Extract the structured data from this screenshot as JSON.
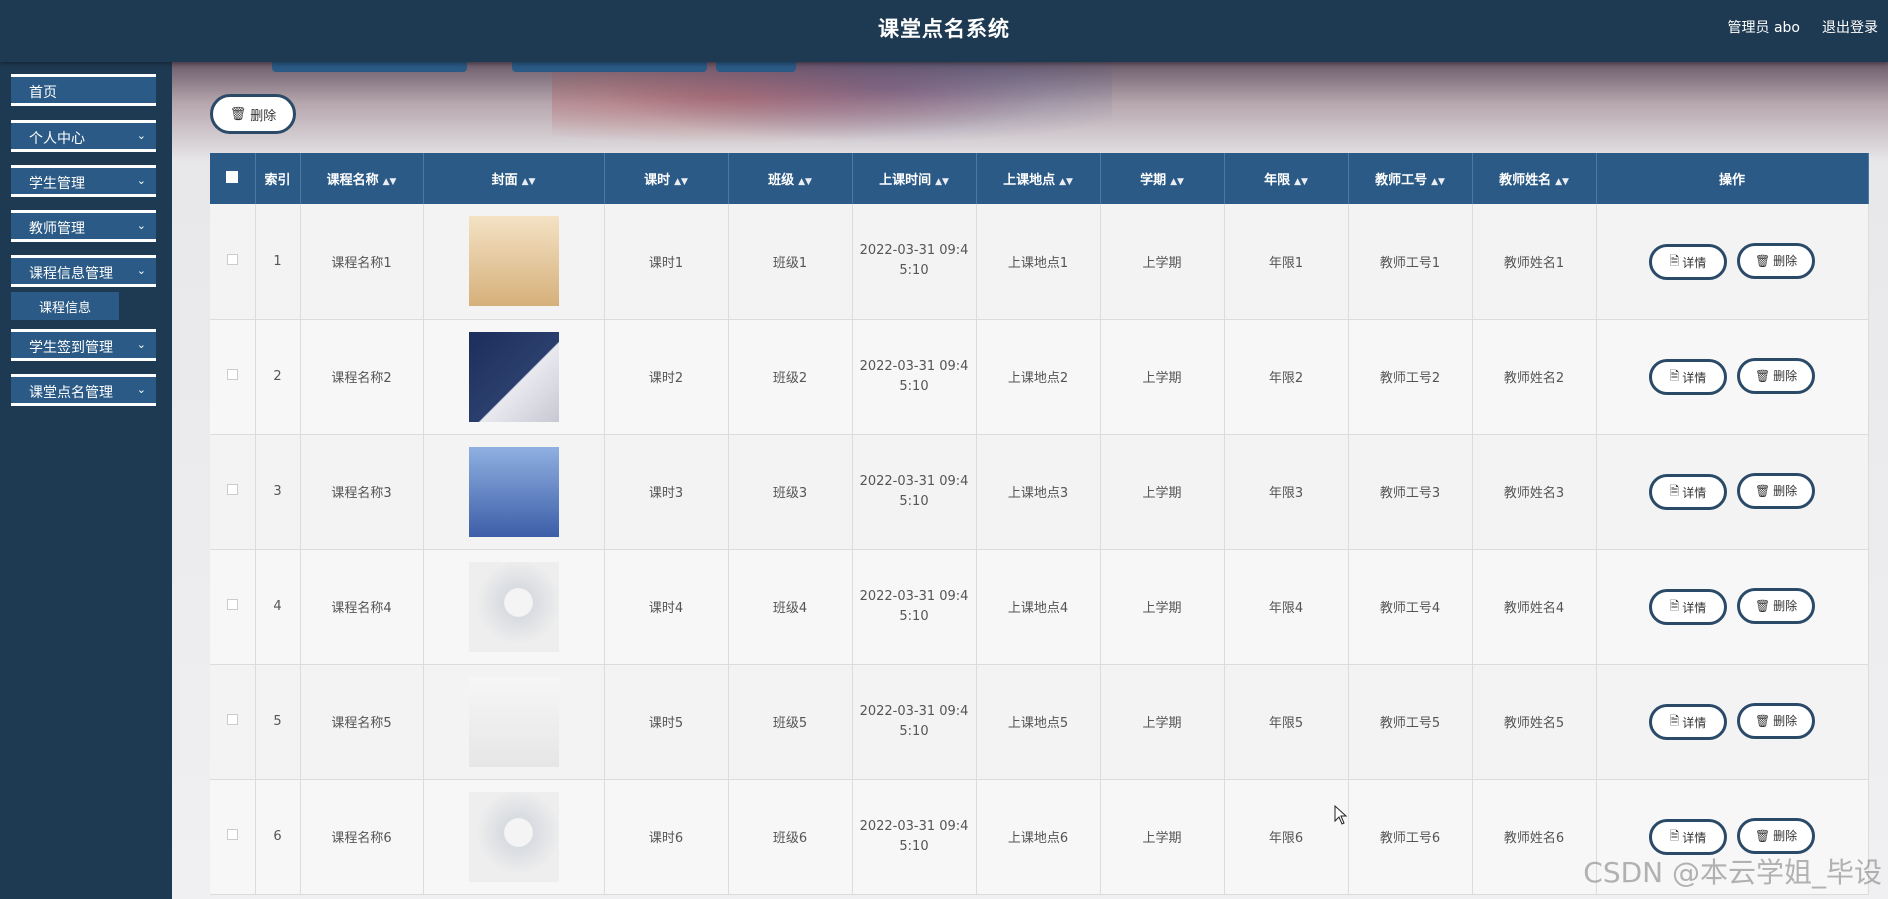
{
  "header": {
    "title": "课堂点名系统",
    "user": "管理员 abo",
    "logout": "退出登录"
  },
  "sidebar": {
    "items": [
      {
        "label": "首页",
        "has_arrow": false
      },
      {
        "label": "个人中心",
        "has_arrow": true
      },
      {
        "label": "学生管理",
        "has_arrow": true
      },
      {
        "label": "教师管理",
        "has_arrow": true
      },
      {
        "label": "课程信息管理",
        "has_arrow": true
      },
      {
        "label": "学生签到管理",
        "has_arrow": true
      },
      {
        "label": "课堂点名管理",
        "has_arrow": true
      }
    ],
    "sub_items": [
      {
        "label": "课程信息",
        "parent": "课程信息管理"
      }
    ]
  },
  "toolbar": {
    "delete_label": "删除"
  },
  "table": {
    "columns": [
      "索引",
      "课程名称",
      "封面",
      "课时",
      "班级",
      "上课时间",
      "上课地点",
      "学期",
      "年限",
      "教师工号",
      "教师姓名",
      "操作"
    ],
    "rows": [
      {
        "index": "1",
        "name": "课程名称1",
        "cover": "cover1",
        "hours": "课时1",
        "class": "班级1",
        "time_a": "2022-03-31 09:4",
        "time_b": "5:10",
        "place": "上课地点1",
        "term": "上学期",
        "years": "年限1",
        "teacher_id": "教师工号1",
        "teacher_name": "教师姓名1"
      },
      {
        "index": "2",
        "name": "课程名称2",
        "cover": "cover2",
        "hours": "课时2",
        "class": "班级2",
        "time_a": "2022-03-31 09:4",
        "time_b": "5:10",
        "place": "上课地点2",
        "term": "上学期",
        "years": "年限2",
        "teacher_id": "教师工号2",
        "teacher_name": "教师姓名2"
      },
      {
        "index": "3",
        "name": "课程名称3",
        "cover": "cover3",
        "hours": "课时3",
        "class": "班级3",
        "time_a": "2022-03-31 09:4",
        "time_b": "5:10",
        "place": "上课地点3",
        "term": "上学期",
        "years": "年限3",
        "teacher_id": "教师工号3",
        "teacher_name": "教师姓名3"
      },
      {
        "index": "4",
        "name": "课程名称4",
        "cover": "cover4",
        "hours": "课时4",
        "class": "班级4",
        "time_a": "2022-03-31 09:4",
        "time_b": "5:10",
        "place": "上课地点4",
        "term": "上学期",
        "years": "年限4",
        "teacher_id": "教师工号4",
        "teacher_name": "教师姓名4"
      },
      {
        "index": "5",
        "name": "课程名称5",
        "cover": "cover5",
        "hours": "课时5",
        "class": "班级5",
        "time_a": "2022-03-31 09:4",
        "time_b": "5:10",
        "place": "上课地点5",
        "term": "上学期",
        "years": "年限5",
        "teacher_id": "教师工号5",
        "teacher_name": "教师姓名5"
      },
      {
        "index": "6",
        "name": "课程名称6",
        "cover": "cover4",
        "hours": "课时6",
        "class": "班级6",
        "time_a": "2022-03-31 09:4",
        "time_b": "5:10",
        "place": "上课地点6",
        "term": "上学期",
        "years": "年限6",
        "teacher_id": "教师工号6",
        "teacher_name": "教师姓名6"
      }
    ],
    "actions": {
      "detail": "详情",
      "delete": "删除"
    }
  },
  "watermark": "CSDN @本云学姐_毕设",
  "colors": {
    "primary": "#2a5a85",
    "sidebar_bg": "#1e3a52",
    "button_border": "#2a4a68"
  }
}
